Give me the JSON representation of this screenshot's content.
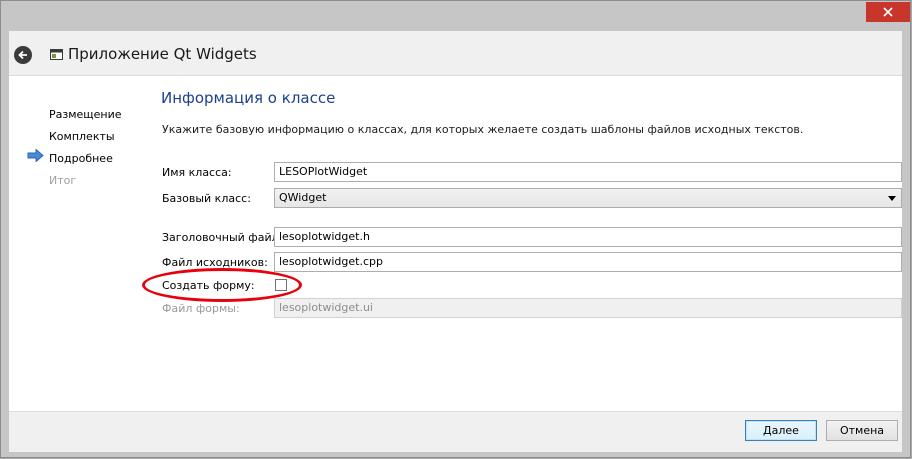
{
  "window": {
    "title": "Приложение Qt Widgets",
    "icons": {
      "back": "back-arrow-icon",
      "app": "app-window-icon",
      "close": "close-icon"
    },
    "close_color": "#c7352b"
  },
  "steps": [
    {
      "label": "Размещение",
      "state": "done"
    },
    {
      "label": "Комплекты",
      "state": "done"
    },
    {
      "label": "Подробнее",
      "state": "current"
    },
    {
      "label": "Итог",
      "state": "future"
    }
  ],
  "page": {
    "title": "Информация о классе",
    "description": "Укажите базовую информацию о классах, для которых желаете создать шаблоны файлов исходных текстов."
  },
  "form": {
    "class_name": {
      "label": "Имя класса:",
      "value": "LESOPlotWidget"
    },
    "base_class": {
      "label": "Базовый класс:",
      "value": "QWidget"
    },
    "header_file": {
      "label": "Заголовочный файл:",
      "value": "lesoplotwidget.h"
    },
    "source_file": {
      "label": "Файл исходников:",
      "value": "lesoplotwidget.cpp"
    },
    "create_form": {
      "label": "Создать форму:",
      "checked": false
    },
    "form_file": {
      "label": "Файл формы:",
      "value": "lesoplotwidget.ui",
      "disabled": true
    }
  },
  "annotation": {
    "color": "#e8000c"
  },
  "buttons": {
    "next": "Далее",
    "cancel": "Отмена"
  },
  "colors": {
    "title_blue": "#1e3f8c",
    "step_arrow": "#4a8bd8"
  }
}
